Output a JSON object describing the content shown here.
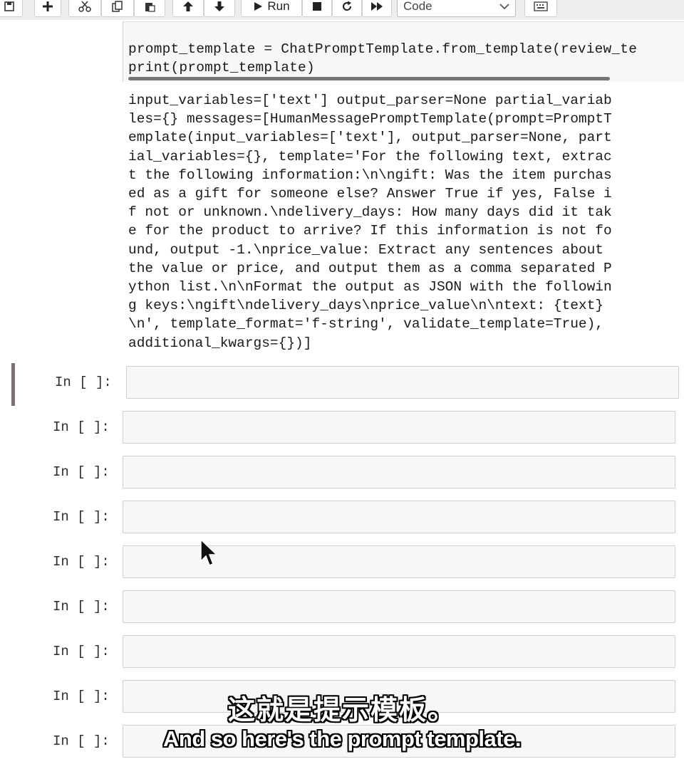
{
  "toolbar": {
    "buttons": [
      {
        "name": "save-icon"
      },
      {
        "name": "plus-icon"
      },
      {
        "name": "scissors-icon"
      },
      {
        "name": "copy-icon"
      },
      {
        "name": "paste-icon"
      },
      {
        "name": "arrow-up-icon"
      },
      {
        "name": "arrow-down-icon"
      },
      {
        "name": "play-icon"
      },
      {
        "name": "stop-icon"
      },
      {
        "name": "restart-icon"
      },
      {
        "name": "fast-forward-icon"
      },
      {
        "name": "keyboard-icon"
      }
    ],
    "run_label": "Run",
    "cell_type": "Code"
  },
  "previous_cell": {
    "code_line_1": "prompt_template = ChatPromptTemplate.from_template(review_te",
    "code_line_2_keyword": "print",
    "code_line_2_rest": "(prompt_template)",
    "output_lines": [
      "input_variables=['text'] output_parser=None partial_variab",
      "les={} messages=[HumanMessagePromptTemplate(prompt=PromptT",
      "emplate(input_variables=['text'], output_parser=None, part",
      "ial_variables={}, template='For the following text, extrac",
      "t the following information:\\n\\ngift: Was the item purchas",
      "ed as a gift for someone else? Answer True if yes, False i",
      "f not or unknown.\\ndelivery_days: How many days did it tak",
      "e for the product to arrive? If this information is not fo",
      "und, output -1.\\nprice_value: Extract any sentences about ",
      "the value or price, and output them as a comma separated P",
      "ython list.\\n\\nFormat the output as JSON with the followin",
      "g keys:\\ngift\\ndelivery_days\\nprice_value\\n\\ntext: {text}",
      "\\n', template_format='f-string', validate_template=True),",
      "additional_kwargs={})]"
    ]
  },
  "empty_cells": [
    {
      "prompt": "In [ ]:"
    },
    {
      "prompt": "In [ ]:"
    },
    {
      "prompt": "In [ ]:"
    },
    {
      "prompt": "In [ ]:"
    },
    {
      "prompt": "In [ ]:"
    },
    {
      "prompt": "In [ ]:"
    },
    {
      "prompt": "In [ ]:"
    },
    {
      "prompt": "In [ ]:"
    },
    {
      "prompt": "In [ ]:"
    }
  ],
  "subtitles": {
    "zh": "这就是提示模板。",
    "en": "And so here's the prompt template."
  }
}
